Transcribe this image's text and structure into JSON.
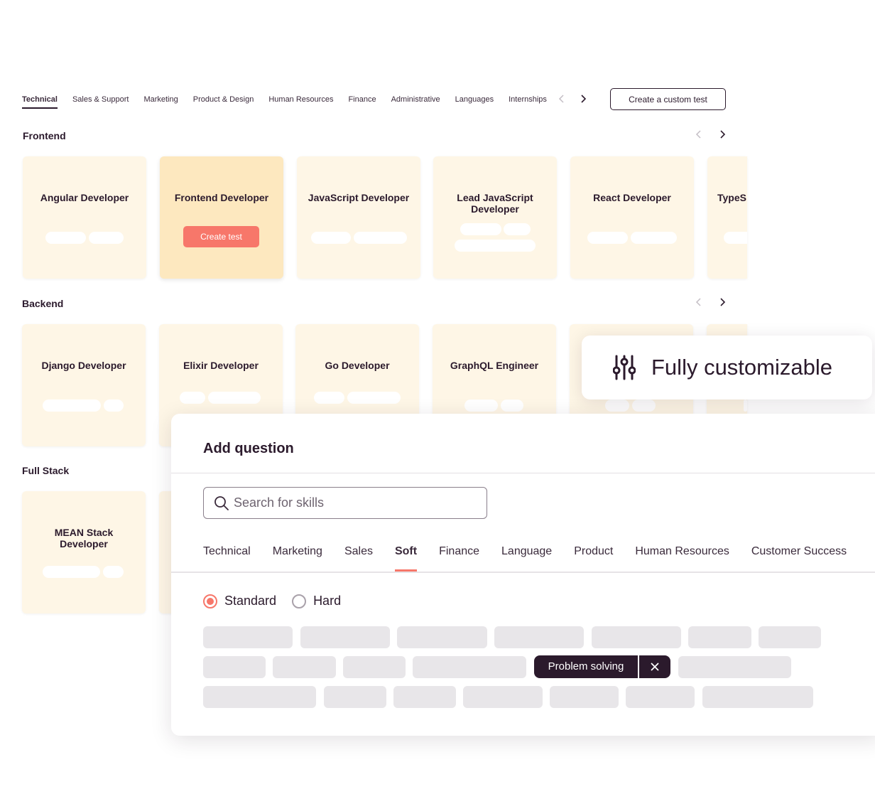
{
  "top_tabs": [
    "Technical",
    "Sales & Support",
    "Marketing",
    "Product & Design",
    "Human Resources",
    "Finance",
    "Administrative",
    "Languages",
    "Internships"
  ],
  "active_top_tab": "Technical",
  "custom_test_label": "Create a custom test",
  "sections": {
    "frontend": {
      "title": "Frontend",
      "cards": [
        "Angular Developer",
        "Frontend  Developer",
        "JavaScript Developer",
        "Lead JavaScript Developer",
        "React Developer",
        "TypeS"
      ]
    },
    "backend": {
      "title": "Backend",
      "cards": [
        "Django Developer",
        "Elixir Developer",
        "Go Developer",
        "GraphQL Engineer"
      ]
    },
    "fullstack": {
      "title": "Full Stack",
      "cards": [
        "MEAN Stack Developer"
      ]
    }
  },
  "create_test_label": "Create test",
  "badge": {
    "text": "Fully customizable",
    "icon": "sliders-icon"
  },
  "modal": {
    "title": "Add question",
    "search_placeholder": "Search for skills",
    "tabs": [
      "Technical",
      "Marketing",
      "Sales",
      "Soft",
      "Finance",
      "Language",
      "Product",
      "Human Resources",
      "Customer Success"
    ],
    "active_tab": "Soft",
    "radios": {
      "standard": "Standard",
      "hard": "Hard",
      "selected": "Standard"
    },
    "selected_skill": "Problem solving"
  },
  "colors": {
    "accent": "#f7776a",
    "dark": "#2b1a2c",
    "card": "#fef6e6",
    "card_highlight": "#fde8bf",
    "skill_placeholder": "#e8e6e9"
  }
}
